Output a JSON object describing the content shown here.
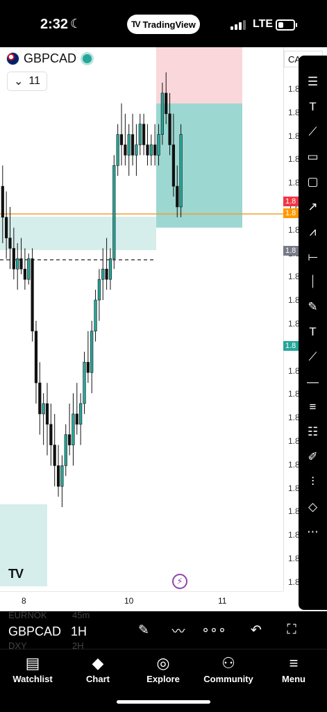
{
  "status_bar": {
    "time": "2:32",
    "network": "LTE",
    "app_pill": "TradingView"
  },
  "chart_header": {
    "symbol": "GBPCAD",
    "interval": "11",
    "price_scale_label": "CA"
  },
  "price_scale": {
    "labels": [
      "1.8",
      "1.8",
      "1.8",
      "1.8",
      "1.8",
      "1.8",
      "1.8",
      "1.8",
      "1.8",
      "1.8",
      "1.8",
      "1.8",
      "1.8",
      "1.8",
      "1.8",
      "1.8",
      "1.8",
      "1.8",
      "1.8",
      "1.8",
      "1.8",
      "1.8"
    ],
    "badges": [
      {
        "text": "1.8",
        "color": "#f23645"
      },
      {
        "text": "1.8",
        "color": "#ff9800"
      },
      {
        "text": "1.8",
        "color": "#787b86"
      },
      {
        "text": "1.8",
        "color": "#26a69a"
      }
    ]
  },
  "time_axis": {
    "labels": [
      "8",
      "10",
      "11"
    ]
  },
  "bottom_bar": {
    "symbol": "GBPCAD",
    "interval": "1H",
    "ghost_rows": [
      {
        "symbol": "EURNOK",
        "interval": "45m"
      },
      {
        "symbol": "DXY",
        "interval": "2H"
      }
    ]
  },
  "tab_bar": [
    {
      "label": "Watchlist",
      "icon": "watchlist-icon"
    },
    {
      "label": "Chart",
      "icon": "chart-icon"
    },
    {
      "label": "Explore",
      "icon": "compass-icon"
    },
    {
      "label": "Community",
      "icon": "community-icon"
    },
    {
      "label": "Menu",
      "icon": "hamburger-icon"
    }
  ],
  "drawing_tools": [
    "horizontal-lines-icon",
    "text-anchor-icon",
    "path-icon",
    "callout-icon",
    "rectangle-icon",
    "arrow-icon",
    "polyline-icon",
    "horizontal-ray-icon",
    "vertical-line-icon",
    "brush-icon",
    "text-icon",
    "trend-line-icon",
    "horizontal-line-icon",
    "parallel-channel-icon",
    "fib-icon",
    "highlighter-icon",
    "bars-pattern-icon",
    "curve-icon",
    "more-icon"
  ],
  "colors": {
    "bull": "#26a69a",
    "bear": "#111111",
    "zone_green": "#b2dfdb",
    "zone_red": "#f7c9cf",
    "stop_line": "#f0a030"
  },
  "chart_data": {
    "type": "candlestick",
    "symbol": "GBPCAD",
    "interval": "1H",
    "x_tick_labels": [
      "8",
      "10",
      "11"
    ],
    "candles": [
      {
        "o": 56,
        "h": 60,
        "l": 45,
        "c": 50
      },
      {
        "o": 50,
        "h": 55,
        "l": 42,
        "c": 46
      },
      {
        "o": 46,
        "h": 52,
        "l": 40,
        "c": 44
      },
      {
        "o": 44,
        "h": 48,
        "l": 38,
        "c": 40
      },
      {
        "o": 40,
        "h": 45,
        "l": 36,
        "c": 42
      },
      {
        "o": 42,
        "h": 46,
        "l": 39,
        "c": 40
      },
      {
        "o": 40,
        "h": 44,
        "l": 36,
        "c": 38
      },
      {
        "o": 38,
        "h": 43,
        "l": 37,
        "c": 42
      },
      {
        "o": 42,
        "h": 44,
        "l": 26,
        "c": 28
      },
      {
        "o": 28,
        "h": 30,
        "l": 14,
        "c": 18
      },
      {
        "o": 18,
        "h": 22,
        "l": 8,
        "c": 12
      },
      {
        "o": 12,
        "h": 16,
        "l": 6,
        "c": 14
      },
      {
        "o": 14,
        "h": 18,
        "l": 4,
        "c": 10
      },
      {
        "o": 10,
        "h": 14,
        "l": 2,
        "c": 6
      },
      {
        "o": 6,
        "h": 12,
        "l": -2,
        "c": 2
      },
      {
        "o": 2,
        "h": 6,
        "l": -4,
        "c": -2
      },
      {
        "o": -2,
        "h": 4,
        "l": -6,
        "c": 2
      },
      {
        "o": 2,
        "h": 10,
        "l": 0,
        "c": 8
      },
      {
        "o": 8,
        "h": 14,
        "l": 4,
        "c": 6
      },
      {
        "o": 6,
        "h": 16,
        "l": 2,
        "c": 12
      },
      {
        "o": 12,
        "h": 18,
        "l": 8,
        "c": 10
      },
      {
        "o": 10,
        "h": 16,
        "l": 6,
        "c": 14
      },
      {
        "o": 14,
        "h": 24,
        "l": 12,
        "c": 22
      },
      {
        "o": 22,
        "h": 28,
        "l": 18,
        "c": 20
      },
      {
        "o": 20,
        "h": 30,
        "l": 16,
        "c": 28
      },
      {
        "o": 28,
        "h": 36,
        "l": 26,
        "c": 34
      },
      {
        "o": 34,
        "h": 40,
        "l": 30,
        "c": 38
      },
      {
        "o": 38,
        "h": 44,
        "l": 34,
        "c": 40
      },
      {
        "o": 40,
        "h": 46,
        "l": 36,
        "c": 38
      },
      {
        "o": 38,
        "h": 44,
        "l": 36,
        "c": 42
      },
      {
        "o": 42,
        "h": 62,
        "l": 40,
        "c": 60
      },
      {
        "o": 60,
        "h": 68,
        "l": 58,
        "c": 66
      },
      {
        "o": 66,
        "h": 72,
        "l": 60,
        "c": 64
      },
      {
        "o": 64,
        "h": 70,
        "l": 60,
        "c": 62
      },
      {
        "o": 62,
        "h": 68,
        "l": 58,
        "c": 66
      },
      {
        "o": 66,
        "h": 70,
        "l": 60,
        "c": 62
      },
      {
        "o": 62,
        "h": 68,
        "l": 58,
        "c": 64
      },
      {
        "o": 64,
        "h": 70,
        "l": 62,
        "c": 68
      },
      {
        "o": 68,
        "h": 70,
        "l": 62,
        "c": 64
      },
      {
        "o": 64,
        "h": 68,
        "l": 60,
        "c": 62
      },
      {
        "o": 62,
        "h": 66,
        "l": 60,
        "c": 64
      },
      {
        "o": 64,
        "h": 68,
        "l": 60,
        "c": 62
      },
      {
        "o": 62,
        "h": 68,
        "l": 60,
        "c": 66
      },
      {
        "o": 66,
        "h": 76,
        "l": 64,
        "c": 74
      },
      {
        "o": 74,
        "h": 78,
        "l": 68,
        "c": 70
      },
      {
        "o": 70,
        "h": 74,
        "l": 62,
        "c": 64
      },
      {
        "o": 64,
        "h": 70,
        "l": 54,
        "c": 56
      },
      {
        "o": 56,
        "h": 60,
        "l": 50,
        "c": 52
      },
      {
        "o": 52,
        "h": 68,
        "l": 50,
        "c": 66
      }
    ],
    "position": {
      "entry": 72,
      "stop": 84,
      "target": 48
    }
  }
}
